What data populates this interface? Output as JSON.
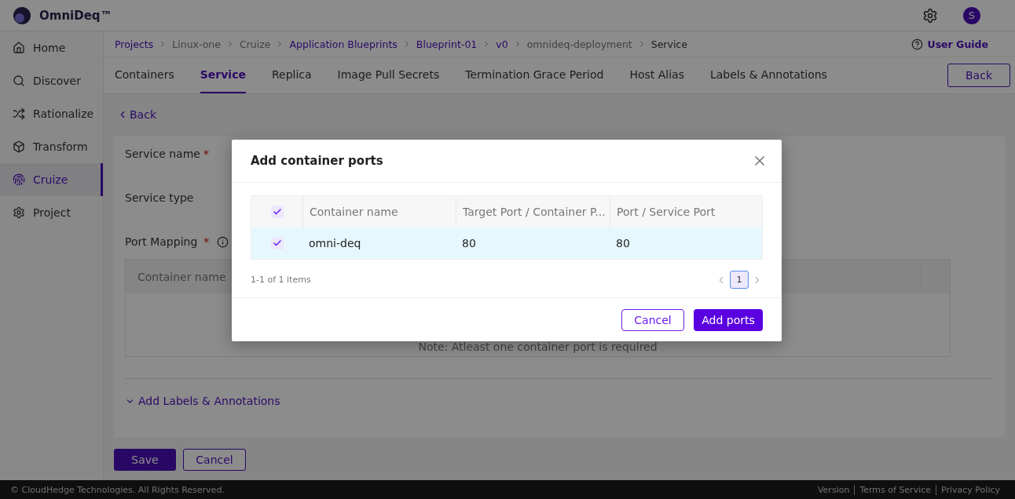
{
  "app": {
    "name": "OmniDeq™",
    "avatar": "S"
  },
  "sidebar": {
    "items": [
      {
        "label": "Home",
        "selected": false
      },
      {
        "label": "Discover",
        "selected": false
      },
      {
        "label": "Rationalize",
        "selected": false
      },
      {
        "label": "Transform",
        "selected": false
      },
      {
        "label": "Cruize",
        "selected": true
      },
      {
        "label": "Project",
        "selected": false
      }
    ]
  },
  "breadcrumb": [
    {
      "label": "Projects",
      "link": true
    },
    {
      "label": "Linux-one",
      "link": false
    },
    {
      "label": "Cruize",
      "link": false
    },
    {
      "label": "Application Blueprints",
      "link": true
    },
    {
      "label": "Blueprint-01",
      "link": true
    },
    {
      "label": "v0",
      "link": true
    },
    {
      "label": "omnideq-deployment",
      "link": false
    },
    {
      "label": "Service",
      "link": false,
      "current": true
    }
  ],
  "user_guide": "User Guide",
  "tabs": [
    {
      "label": "Containers",
      "selected": false
    },
    {
      "label": "Service",
      "selected": true
    },
    {
      "label": "Replica",
      "selected": false
    },
    {
      "label": "Image Pull Secrets",
      "selected": false
    },
    {
      "label": "Termination Grace Period",
      "selected": false
    },
    {
      "label": "Host Alias",
      "selected": false
    },
    {
      "label": "Labels & Annotations",
      "selected": false
    }
  ],
  "back_button": "Back",
  "back_link": "Back",
  "form": {
    "fields": [
      {
        "label": "Service name",
        "required_mark": "*"
      },
      {
        "label": "Service type"
      }
    ],
    "port_mapping": {
      "label": "Port Mapping",
      "required_mark": "*",
      "columns": [
        "Container name"
      ],
      "note": "Note: Atleast one container port is required"
    },
    "labels_toggle": "Add Labels & Annotations"
  },
  "actions": {
    "save": "Save",
    "cancel": "Cancel"
  },
  "modal": {
    "title": "Add container ports",
    "columns": [
      "Container name",
      "Target Port / Container P...",
      "Port / Service Port"
    ],
    "header_checked": true,
    "rows": [
      {
        "checked": true,
        "selected": true,
        "cells": [
          "omni-deq",
          "80",
          "80"
        ]
      }
    ],
    "summary": "1-1 of 1 items",
    "pages": [
      {
        "label": "1",
        "selected": true
      }
    ],
    "cancel": "Cancel",
    "confirm": "Add ports"
  },
  "footer": {
    "copyright": "© CloudHedge Technologies. All Rights Reserved.",
    "links": [
      "Version",
      "Terms of Service",
      "Privacy Policy"
    ]
  }
}
